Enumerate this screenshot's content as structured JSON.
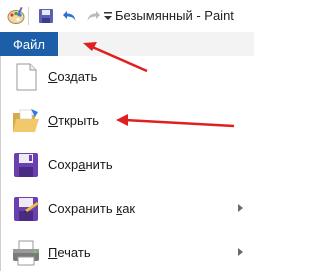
{
  "window": {
    "title": "Безымянный - Paint"
  },
  "ribbon": {
    "file_tab_label": "Файл"
  },
  "menu": {
    "items": [
      {
        "label_first": "С",
        "label_rest": "оздать",
        "icon": "new-document-icon",
        "has_submenu": false
      },
      {
        "label_first": "О",
        "label_rest": "ткрыть",
        "icon": "open-folder-icon",
        "has_submenu": false
      },
      {
        "label_first": "Сохр",
        "label_underline": "а",
        "label_rest": "нить",
        "icon": "save-disk-icon",
        "has_submenu": false
      },
      {
        "label_first": "Сохранить ",
        "label_underline": "к",
        "label_rest": "ак",
        "icon": "save-as-icon",
        "has_submenu": true
      },
      {
        "label_first": "П",
        "label_rest": "ечать",
        "icon": "printer-icon",
        "has_submenu": true
      }
    ]
  },
  "annotations": {
    "arrow_color": "#e02020"
  }
}
